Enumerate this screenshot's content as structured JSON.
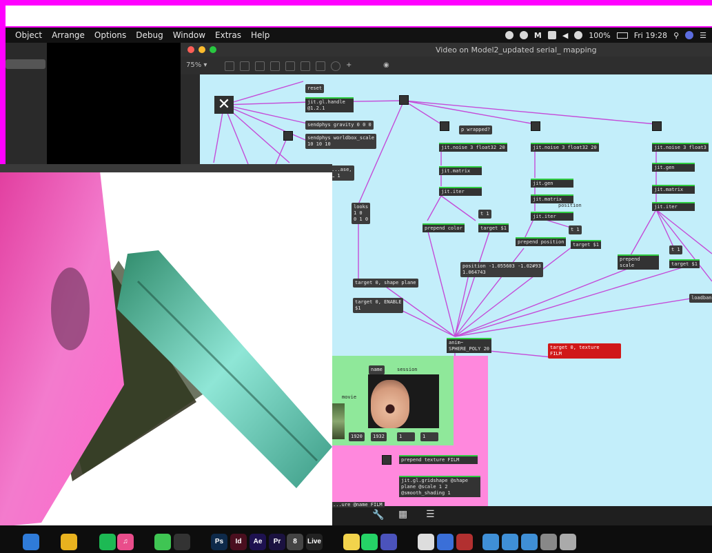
{
  "menubar": {
    "items": [
      "Object",
      "Arrange",
      "Options",
      "Debug",
      "Window",
      "Extras",
      "Help"
    ],
    "battery": "100%",
    "clock": "Fri 19:28"
  },
  "window": {
    "title": "Video on Model2_updated serial_ mapping",
    "zoom": "75% ▾"
  },
  "patch": {
    "reset": "reset",
    "handle": "jit.gl.handle\n@1.2.1",
    "sendphys_gravity": "sendphys gravity 0 0 0",
    "sendphys_world": "sendphys worldbox_scale\n10 10 10",
    "window_obj": "...ase,\n… 1",
    "looks": "looks\n1 0\n0 1 0",
    "wrapped": "p wrapped?",
    "noise1": "jit.noise 3 float32 20",
    "noise2": "jit.noise 3 float32 20",
    "noise3": "jit.noise 3 float3",
    "matrix1": "jit.matrix",
    "iter1": "jit.iter",
    "gen2": "jit.gen",
    "matrix2": "jit.matrix",
    "iter2": "jit.iter",
    "gen3": "jit.gen",
    "matrix3": "jit.matrix",
    "iter3": "jit.iter",
    "comment_position": "position",
    "trig1": "t 1",
    "trig2": "t 1",
    "trig3": "t 1",
    "prepend_color": "prepend color",
    "target1": "target $1",
    "prepend_position": "prepend position",
    "target2": "target $1",
    "prepend_scale": "prepend\nscale",
    "target3": "target $1",
    "position_msg": "position -1.055603 -1.02#93\n1.064743",
    "shape_msg": "target 0, shape plane",
    "enable_msg": "target 0, ENABLE\n$1",
    "multi_shape": "anim~\nSPHERE_POLY 20",
    "texture_msg": "target 0, texture\nFILM",
    "loadbang": "loadban",
    "name_label": "name",
    "session_label": "session",
    "movie_label": "movie",
    "w_value": "1920",
    "h_value": "1932",
    "v1": "1",
    "v2": "1",
    "prepend_texture": "prepend texture FILM",
    "gridshape": "jit.gl.gridshape @shape\nplane @scale 1 2\n@smooth_shading 1",
    "bottom_label": "...ure @name FILM"
  },
  "dock": {
    "icons": [
      {
        "name": "finder-icon",
        "label": "",
        "color": "#2f7bd8"
      },
      {
        "name": "chrome-icon",
        "label": "",
        "color": "#e8b21f"
      },
      {
        "name": "spotify-icon",
        "label": "",
        "color": "#1db954"
      },
      {
        "name": "itunes-icon",
        "label": "♫",
        "color": "#e94d8b"
      },
      {
        "name": "messages-icon",
        "label": "",
        "color": "#3fc553"
      },
      {
        "name": "terminal-icon",
        "label": "",
        "color": "#333333"
      },
      {
        "name": "photoshop-icon",
        "label": "Ps",
        "color": "#0e2a4a"
      },
      {
        "name": "indesign-icon",
        "label": "Id",
        "color": "#4a0f1f"
      },
      {
        "name": "aftereffects-icon",
        "label": "Ae",
        "color": "#1e1250"
      },
      {
        "name": "premiere-icon",
        "label": "Pr",
        "color": "#1b1240"
      },
      {
        "name": "max-icon",
        "label": "8",
        "color": "#444444"
      },
      {
        "name": "live-icon",
        "label": "Live",
        "color": "#222222"
      },
      {
        "name": "notes-icon",
        "label": "",
        "color": "#f2d34c"
      },
      {
        "name": "whatsapp-icon",
        "label": "",
        "color": "#25d366"
      },
      {
        "name": "teams-icon",
        "label": "",
        "color": "#4b53bc"
      },
      {
        "name": "textedit-icon",
        "label": "",
        "color": "#dddddd"
      },
      {
        "name": "quicktime-icon",
        "label": "",
        "color": "#3a6fd8"
      },
      {
        "name": "photobooth-icon",
        "label": "",
        "color": "#b23030"
      },
      {
        "name": "folder-icon",
        "label": "",
        "color": "#3f8fd6"
      },
      {
        "name": "folder-icon",
        "label": "",
        "color": "#3f8fd6"
      },
      {
        "name": "folder-icon",
        "label": "",
        "color": "#3f8fd6"
      },
      {
        "name": "drive-icon",
        "label": "",
        "color": "#888888"
      },
      {
        "name": "trash-icon",
        "label": "",
        "color": "#aaaaaa"
      }
    ]
  }
}
